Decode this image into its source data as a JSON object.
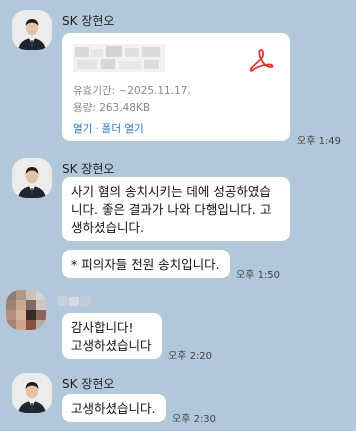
{
  "messages": [
    {
      "sender": "SK 장현오",
      "file": {
        "validity": "유효기간: ~2025.11.17.",
        "size": "용량: 263.48KB",
        "open_label": "열기",
        "separator": "·",
        "open_folder_label": "폴더 열기"
      },
      "time": "오후 1:49"
    },
    {
      "sender": "SK 장현오",
      "bubbles": [
        {
          "lines": [
            "사기 혐의 송치시키는 데에 성공하였습",
            "니다. 좋은 결과가 나와 다행입니다. 고",
            "생하셨습니다."
          ]
        },
        {
          "text": "* 피의자들 전원 송치입니다.",
          "time": "오후 1:50"
        }
      ]
    },
    {
      "bubbles": [
        {
          "lines": [
            "감사합니다!",
            "고생하셨습니다"
          ],
          "time": "오후 2:20"
        }
      ]
    },
    {
      "sender": "SK 장현오",
      "bubbles": [
        {
          "text": "고생하셨습니다.",
          "time": "오후 2:30"
        }
      ]
    }
  ],
  "colors": {
    "background": "#b2c7d9",
    "bubble": "#ffffff",
    "pdf_icon": "#e0322d",
    "link": "#2d74c3"
  },
  "icons": [
    "person-avatar",
    "pdf-icon",
    "blurred-avatar"
  ]
}
